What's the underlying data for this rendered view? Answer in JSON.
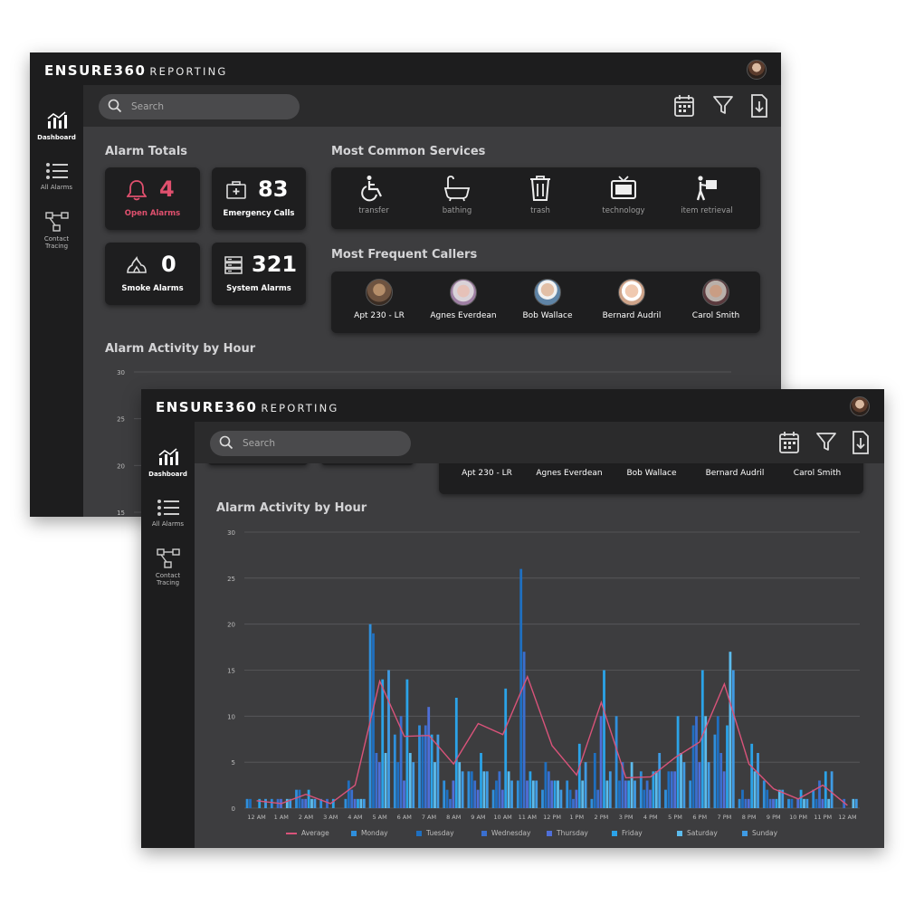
{
  "app": {
    "brand": "ENSURE360",
    "brand_suffix": "REPORTING",
    "user_avatar_icon": "user-avatar"
  },
  "sidebar": {
    "items": [
      {
        "label": "Dashboard",
        "icon": "bar-chart-icon",
        "active": true
      },
      {
        "label": "All Alarms",
        "icon": "list-icon",
        "active": false
      },
      {
        "label": "Contact Tracing",
        "icon": "network-icon",
        "active": false
      }
    ]
  },
  "search": {
    "placeholder": "Search"
  },
  "toolbar": {
    "icons": [
      "calendar-icon",
      "filter-icon",
      "download-icon"
    ]
  },
  "alarm_totals": {
    "title": "Alarm Totals",
    "cards": [
      {
        "value": "4",
        "label": "Open Alarms",
        "icon": "bell-icon",
        "color": "#e0506e"
      },
      {
        "value": "83",
        "label": "Emergency Calls",
        "icon": "first-aid-icon",
        "color": "#ffffff"
      },
      {
        "value": "0",
        "label": "Smoke Alarms",
        "icon": "fire-icon",
        "color": "#ffffff"
      },
      {
        "value": "321",
        "label": "System Alarms",
        "icon": "server-icon",
        "color": "#ffffff"
      }
    ]
  },
  "services": {
    "title": "Most Common Services",
    "items": [
      {
        "label": "transfer",
        "icon": "wheelchair-icon"
      },
      {
        "label": "bathing",
        "icon": "bathtub-icon"
      },
      {
        "label": "trash",
        "icon": "trash-icon"
      },
      {
        "label": "technology",
        "icon": "tv-icon"
      },
      {
        "label": "item retrieval",
        "icon": "carry-box-icon"
      }
    ]
  },
  "callers": {
    "title": "Most Frequent Callers",
    "items": [
      {
        "name": "Apt 230 - LR"
      },
      {
        "name": "Agnes Everdean"
      },
      {
        "name": "Bob Wallace"
      },
      {
        "name": "Bernard Audril"
      },
      {
        "name": "Carol Smith"
      }
    ]
  },
  "activity": {
    "title": "Alarm Activity by Hour"
  },
  "colors": {
    "average": "#d9537a",
    "monday": "#2f8fdc",
    "tuesday": "#1f6fc0",
    "wednesday": "#3a6fcf",
    "thursday": "#4f6fd8",
    "friday": "#2ba3e8",
    "saturday": "#5cbbec",
    "sunday": "#3f9be4"
  },
  "chart_data": {
    "type": "bar",
    "title": "Alarm Activity by Hour",
    "ylim": [
      0,
      30
    ],
    "yticks": [
      0,
      5,
      10,
      15,
      20,
      25,
      30
    ],
    "grid": true,
    "legend_position": "bottom",
    "categories": [
      "12 AM",
      "1 AM",
      "2 AM",
      "3 AM",
      "4 AM",
      "5 AM",
      "6 AM",
      "7 AM",
      "8 AM",
      "9 AM",
      "10 AM",
      "11 AM",
      "12 PM",
      "1 PM",
      "2 PM",
      "3 PM",
      "4 PM",
      "5 PM",
      "6 PM",
      "7 PM",
      "8 PM",
      "9 PM",
      "10 PM",
      "11 PM",
      "12 AM"
    ],
    "series": [
      {
        "name": "Monday",
        "values": [
          1,
          1,
          2,
          1,
          1,
          20,
          8,
          9,
          3,
          4,
          2,
          3,
          2,
          3,
          1,
          10,
          4,
          2,
          3,
          8,
          1,
          3,
          1,
          2,
          0
        ]
      },
      {
        "name": "Tuesday",
        "values": [
          1,
          0,
          2,
          0,
          3,
          19,
          5,
          8,
          2,
          4,
          3,
          26,
          5,
          2,
          6,
          3,
          2,
          4,
          9,
          10,
          2,
          2,
          1,
          1,
          0
        ]
      },
      {
        "name": "Wednesday",
        "values": [
          0,
          1,
          1,
          1,
          2,
          6,
          10,
          9,
          1,
          3,
          4,
          17,
          4,
          1,
          2,
          5,
          3,
          4,
          10,
          6,
          1,
          1,
          0,
          3,
          1
        ]
      },
      {
        "name": "Thursday",
        "values": [
          0,
          1,
          1,
          0,
          1,
          5,
          3,
          11,
          3,
          2,
          2,
          3,
          3,
          2,
          10,
          3,
          2,
          4,
          5,
          4,
          1,
          1,
          1,
          1,
          0
        ]
      },
      {
        "name": "Friday",
        "values": [
          1,
          0,
          2,
          1,
          1,
          14,
          14,
          8,
          12,
          6,
          13,
          4,
          3,
          7,
          15,
          3,
          4,
          10,
          15,
          9,
          7,
          1,
          2,
          4,
          0
        ]
      },
      {
        "name": "Saturday",
        "values": [
          0,
          1,
          1,
          0,
          1,
          6,
          6,
          5,
          5,
          4,
          4,
          3,
          3,
          3,
          3,
          5,
          4,
          6,
          10,
          17,
          4,
          2,
          1,
          1,
          1
        ]
      },
      {
        "name": "Sunday",
        "values": [
          1,
          1,
          1,
          0,
          1,
          15,
          5,
          8,
          4,
          4,
          3,
          3,
          2,
          5,
          4,
          3,
          6,
          5,
          5,
          15,
          6,
          2,
          1,
          4,
          1
        ]
      },
      {
        "name": "Average",
        "values": [
          0.8,
          0.5,
          1.5,
          0.5,
          2.5,
          13.8,
          7.8,
          7.9,
          4.8,
          9.2,
          8.0,
          14.3,
          6.8,
          3.6,
          11.5,
          3.3,
          3.4,
          5.5,
          7.2,
          13.5,
          4.8,
          2.1,
          1.0,
          2.5,
          0.3
        ]
      }
    ]
  }
}
